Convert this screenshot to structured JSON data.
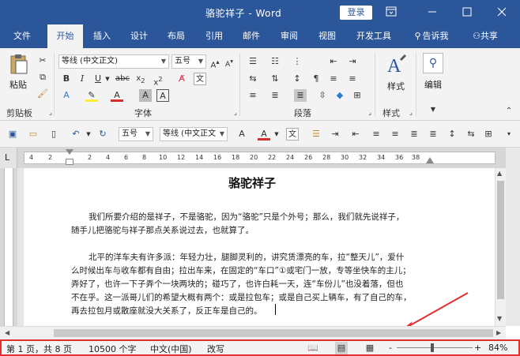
{
  "window": {
    "title": "骆驼祥子 - Word",
    "login": "登录"
  },
  "tabs": [
    "文件",
    "开始",
    "插入",
    "设计",
    "布局",
    "引用",
    "邮件",
    "审阅",
    "视图",
    "开发工具"
  ],
  "tellme": "告诉我",
  "share": "共享",
  "ribbon": {
    "clipboard": {
      "paste": "粘贴",
      "label": "剪贴板"
    },
    "font": {
      "name": "等线 (中文正文)",
      "size": "五号",
      "label": "字体"
    },
    "paragraph": {
      "label": "段落"
    },
    "styles": {
      "button": "样式",
      "label": "样式"
    },
    "editing": {
      "button": "编辑"
    }
  },
  "qat": {
    "font_size": "五号",
    "font_name": "等线 (中文正文"
  },
  "ruler": {
    "left_numbers": [
      "4",
      "2"
    ],
    "numbers": [
      "2",
      "4",
      "6",
      "8",
      "10",
      "12",
      "14",
      "16",
      "18",
      "20",
      "22",
      "24",
      "26",
      "28",
      "30",
      "32",
      "34",
      "36",
      "38"
    ]
  },
  "document": {
    "heading": "骆驼祥子",
    "paragraph1": [
      "我们所要介绍的是祥子，不是骆驼，因为“骆驼”只是个外号；那么，我们就先说祥子，",
      "随手儿把骆驼与祥子那点关系说过去，也就算了。"
    ],
    "paragraph2": [
      "北平的洋车夫有许多派：年轻力壮，腿脚灵利的，讲究赁漂亮的车，拉“整天儿”，爱什",
      "么时候出车与收车都有自由；拉出车来，在固定的“车口”①或宅门一放，专等坐快车的主儿；",
      "弄好了，也许一下子弄个一块两块的；碰巧了，也许白耗一天，连“车份儿”也没着落，但也",
      "不在乎。这一派哥儿们的希望大概有两个：或是拉包车；或是自己买上辆车，有了自己的车，",
      "再去拉包月或散座就没大关系了，反正车是自己的。"
    ]
  },
  "status": {
    "page": "第 1 页，共 8 页",
    "words": "10500 个字",
    "language": "中文(中国)",
    "mode": "改写",
    "zoom_minus": "-",
    "zoom_plus": "+",
    "zoom": "84%",
    "zoom_level": 0.84
  },
  "colors": {
    "brand": "#2b579a",
    "highlight": "#e03030",
    "font_color": "#d32f2f",
    "highlight_color": "#ffeb3b"
  }
}
